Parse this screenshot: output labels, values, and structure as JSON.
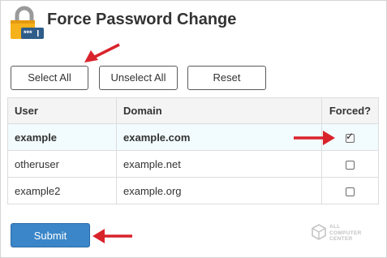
{
  "page": {
    "title": "Force Password Change"
  },
  "toolbar": {
    "select_all_label": "Select All",
    "unselect_all_label": "Unselect All",
    "reset_label": "Reset"
  },
  "table": {
    "columns": [
      "User",
      "Domain",
      "Forced?"
    ],
    "rows": [
      {
        "user": "example",
        "domain": "example.com",
        "forced": true,
        "highlighted": true
      },
      {
        "user": "otheruser",
        "domain": "example.net",
        "forced": false,
        "highlighted": false
      },
      {
        "user": "example2",
        "domain": "example.org",
        "forced": false,
        "highlighted": false
      }
    ]
  },
  "form": {
    "submit_label": "Submit"
  },
  "icons": {
    "header": "lock-password-icon",
    "annotation": "red-arrow-icon",
    "watermark": "all-computer-center-logo"
  },
  "watermark": {
    "lines": [
      "ALL",
      "COMPUTER",
      "CENTER"
    ]
  },
  "colors": {
    "submit_bg": "#3a86c8",
    "row_highlight": "#f2fbfd",
    "arrow": "#d9232b",
    "lock_body": "#f5b21a",
    "lock_shackle": "#9a9a9a",
    "password_field": "#2f5d8a"
  }
}
